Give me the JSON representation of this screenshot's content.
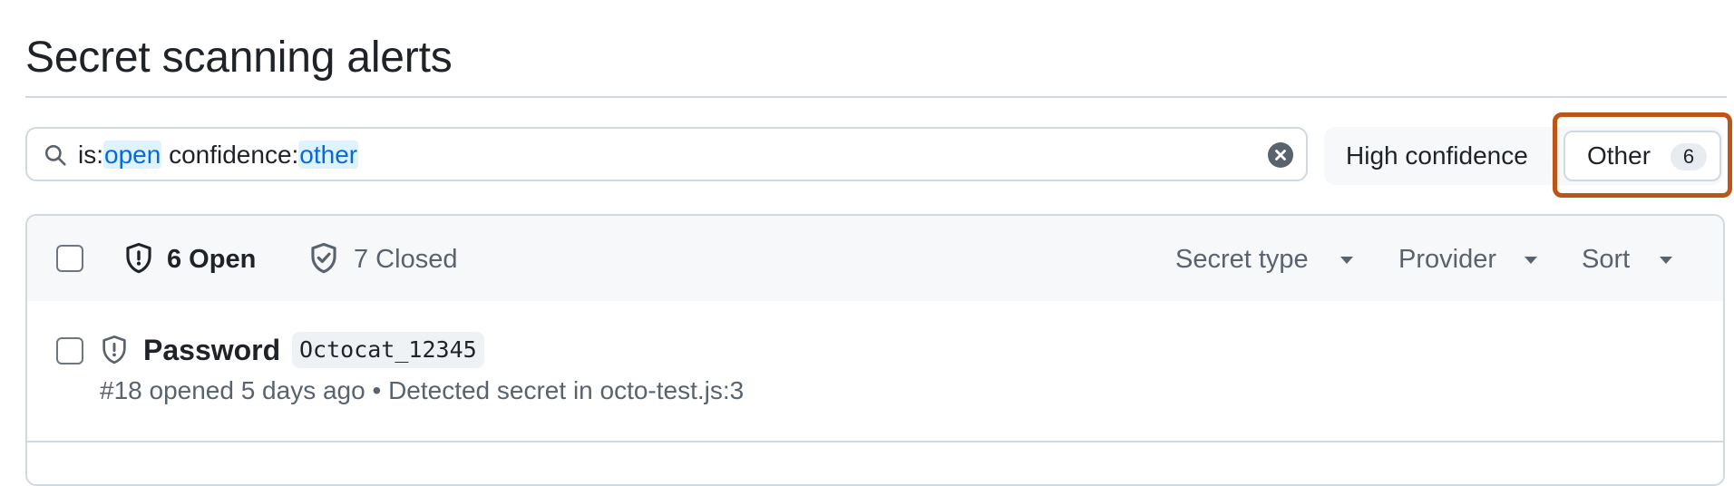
{
  "page": {
    "title": "Secret scanning alerts"
  },
  "search": {
    "query_parts": [
      {
        "text": "is:",
        "token": false
      },
      {
        "text": "open",
        "token": true
      },
      {
        "text": " confidence:",
        "token": false
      },
      {
        "text": "other",
        "token": true
      }
    ]
  },
  "confidence_toggle": {
    "high_label": "High confidence",
    "other_label": "Other",
    "other_count": "6",
    "selected": "Other"
  },
  "table_header": {
    "open_label": "6 Open",
    "closed_label": "7 Closed",
    "filters": {
      "secret_type": "Secret type",
      "provider": "Provider",
      "sort": "Sort"
    }
  },
  "alerts": [
    {
      "title": "Password",
      "secret": "Octocat_12345",
      "meta": "#18 opened 5 days ago • Detected secret in octo-test.js:3"
    }
  ],
  "colors": {
    "highlight": "#bc5516",
    "token": "#0969da",
    "token_bg": "#ddf4ff"
  },
  "icons": [
    "search-icon",
    "clear-icon",
    "shield-alert-icon",
    "shield-check-icon",
    "caret-down-icon"
  ]
}
